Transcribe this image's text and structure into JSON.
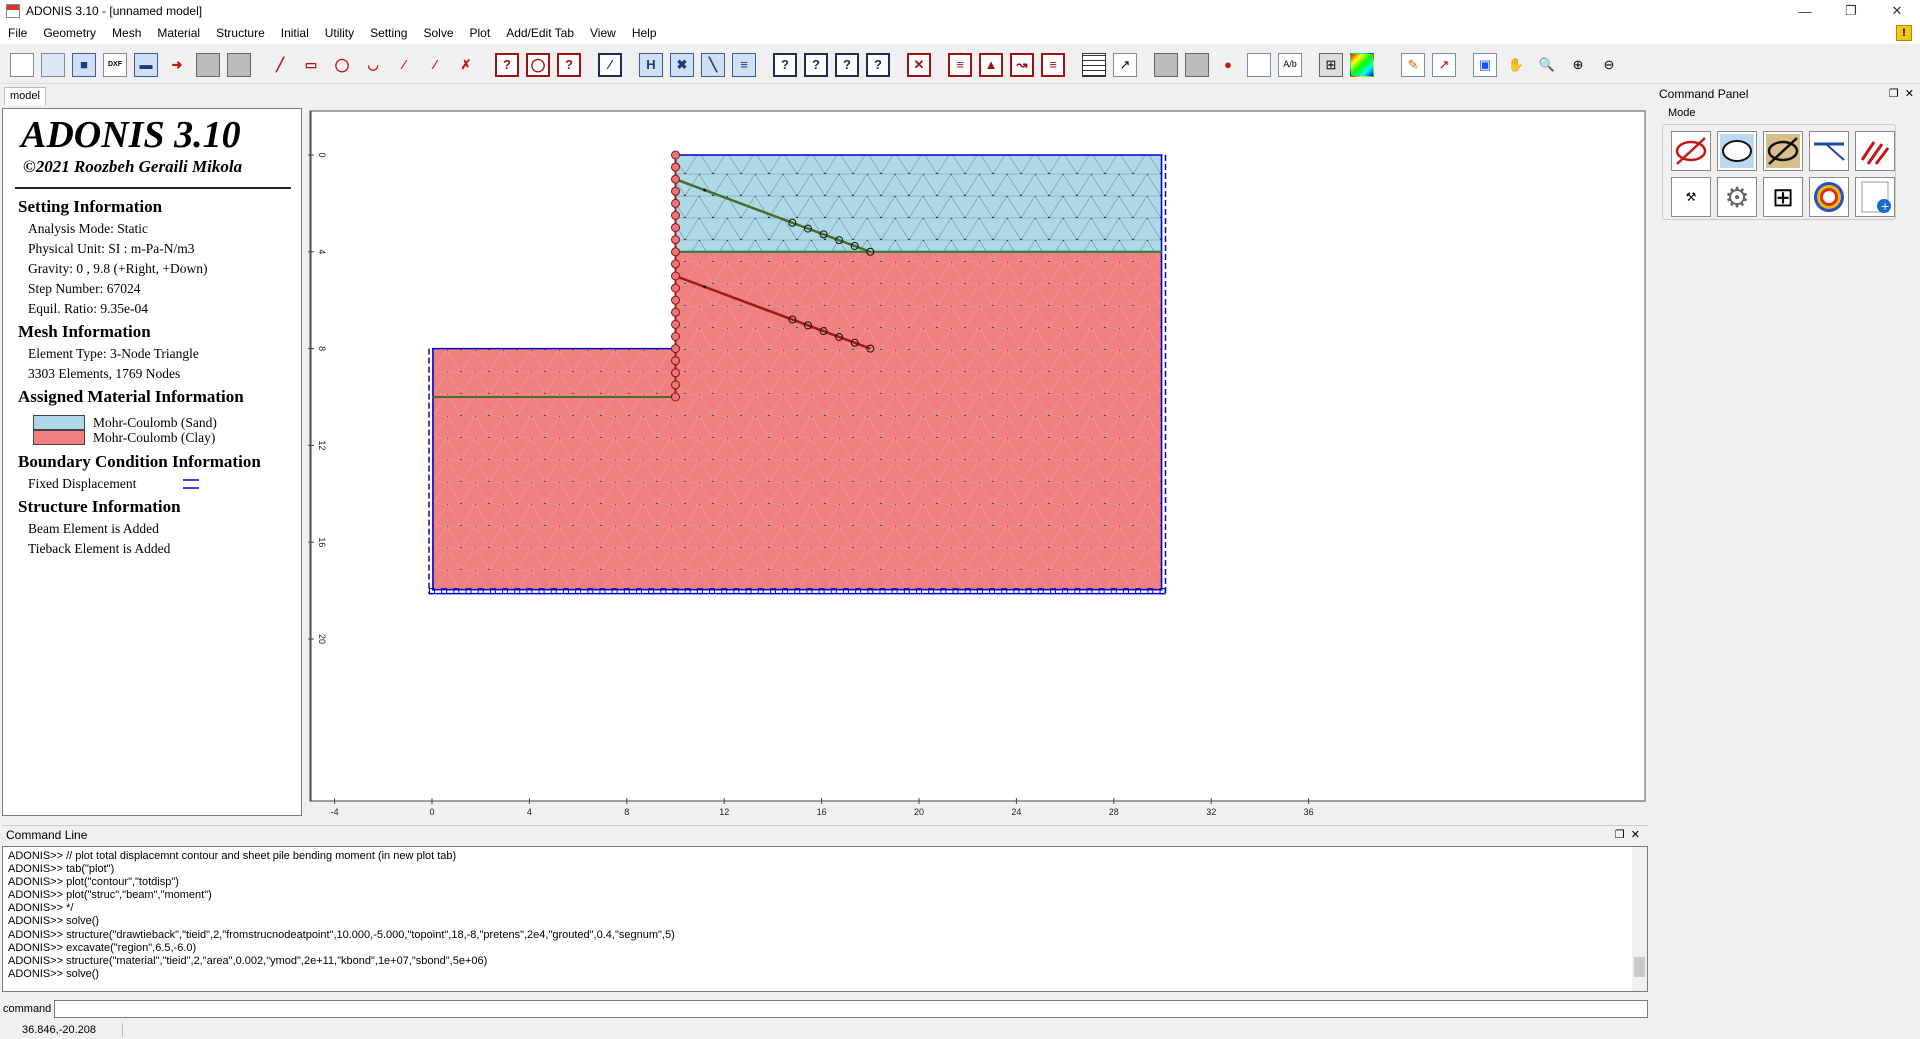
{
  "window": {
    "title": "ADONIS 3.10 - [unnamed model]"
  },
  "menu": [
    "File",
    "Geometry",
    "Mesh",
    "Material",
    "Structure",
    "Initial",
    "Utility",
    "Setting",
    "Solve",
    "Plot",
    "Add/Edit Tab",
    "View",
    "Help"
  ],
  "tabs": {
    "model": "model"
  },
  "info": {
    "app_title": "ADONIS 3.10",
    "copyright": "©2021 Roozbeh Geraili Mikola",
    "setting_head": "Setting Information",
    "setting_lines": [
      "Analysis Mode: Static",
      "Physical Unit: SI : m-Pa-N/m3",
      "Gravity: 0 , 9.8 (+Right, +Down)",
      "Step Number: 67024",
      "Equil. Ratio: 9.35e-04"
    ],
    "mesh_head": "Mesh Information",
    "mesh_lines": [
      "Element Type: 3-Node Triangle",
      "3303 Elements, 1769 Nodes"
    ],
    "material_head": "Assigned Material Information",
    "materials": [
      {
        "name": "Mohr-Coulomb (Sand)",
        "color": "#add8e6"
      },
      {
        "name": "Mohr-Coulomb (Clay)",
        "color": "#f08080"
      }
    ],
    "bc_head": "Boundary Condition Information",
    "bc_lines": [
      "Fixed Displacement"
    ],
    "struct_head": "Structure Information",
    "struct_lines": [
      "Beam Element is Added",
      "Tieback Element is Added"
    ]
  },
  "plot": {
    "x_ticks": [
      "-4",
      "0",
      "4",
      "8",
      "12",
      "16",
      "20",
      "24",
      "28",
      "32",
      "36"
    ],
    "y_ticks": [
      "0",
      "4",
      "8",
      "12",
      "16",
      "20"
    ],
    "sand_color": "#add8e6",
    "clay_color": "#f08080",
    "boundary_color": "#0000cc",
    "tieback_upper_color": "#4a6b2a",
    "tieback_lower_color": "#a01818"
  },
  "command_panel": {
    "title": "Command Panel",
    "mode_label": "Mode",
    "mode_buttons": [
      "geometry-mode-icon",
      "mesh-mode-icon",
      "material-mode-icon",
      "structure-mode-icon",
      "boundary-mode-icon",
      "utility-mode-icon",
      "settings-gear-icon",
      "calculator-icon",
      "contour-mode-icon",
      "add-tab-icon"
    ]
  },
  "command_line": {
    "title": "Command Line",
    "log": [
      "ADONIS>> // plot total displacemnt contour and sheet pile bending moment (in new plot tab)",
      "ADONIS>> tab(\"plot\")",
      "ADONIS>> plot(\"contour\",\"totdisp\")",
      "ADONIS>> plot(\"struc\",\"beam\",\"moment\")",
      "ADONIS>> */",
      "ADONIS>> solve()",
      "ADONIS>> structure(\"drawtieback\",\"tieid\",2,\"fromstrucnodeatpoint\",10.000,-5.000,\"topoint\",18,-8,\"pretens\",2e4,\"grouted\",0.4,\"segnum\",5)",
      "ADONIS>> excavate(\"region\",6.5,-6.0)",
      "ADONIS>> structure(\"material\",\"tieid\",2,\"area\",0.002,\"ymod\",2e+11,\"kbond\",1e+07,\"sbond\",5e+06)",
      "ADONIS>> solve()"
    ],
    "input_label": "command",
    "input_value": ""
  },
  "status": {
    "coords": "36.846,-20.208"
  }
}
